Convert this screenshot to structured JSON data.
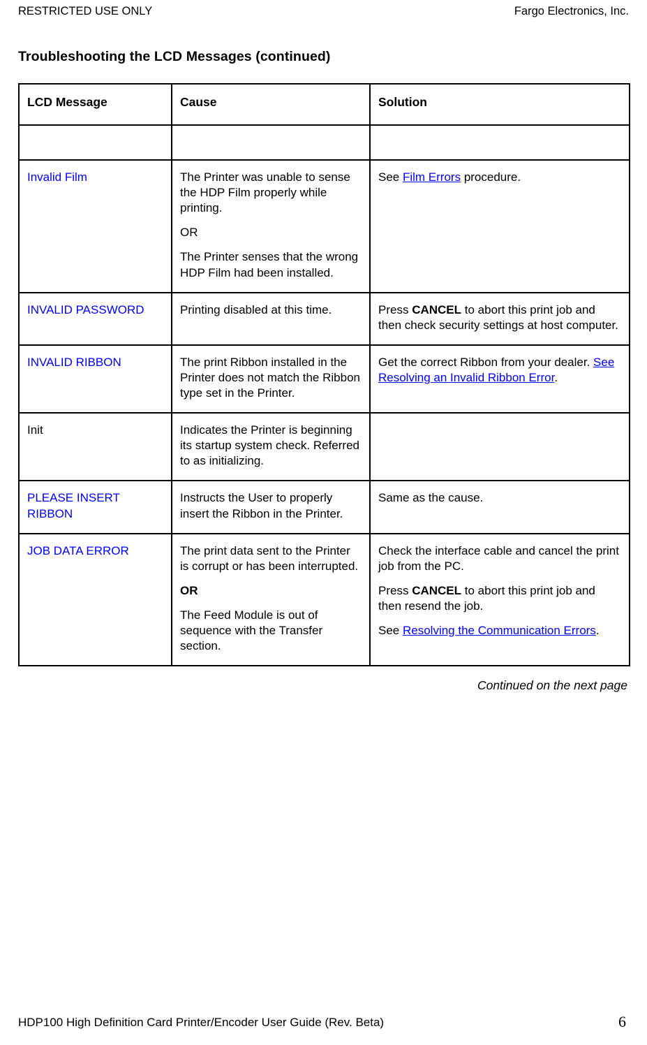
{
  "running_header": {
    "left": "RESTRICTED USE ONLY",
    "right": "Fargo Electronics, Inc."
  },
  "section_title": "Troubleshooting the LCD Messages (continued)",
  "table": {
    "headers": {
      "lcd_message": "LCD Message",
      "cause": "Cause",
      "solution": "Solution"
    },
    "rows": [
      {
        "message": "Invalid Film",
        "message_style": "blue",
        "cause": {
          "p1": "The Printer was unable to sense the HDP Film properly while printing.",
          "p2": "OR",
          "p2_bold": false,
          "p3": "The Printer senses that the wrong HDP Film had been installed."
        },
        "solution": {
          "p1_pre": "See ",
          "p1_link": "Film Errors",
          "p1_post": " procedure."
        }
      },
      {
        "message": "INVALID PASSWORD",
        "message_style": "blue",
        "cause": {
          "p1": "Printing disabled at this time."
        },
        "solution": {
          "p1_pre": "Press ",
          "p1_bold": "CANCEL",
          "p1_post": " to abort this print job and then check security settings at host computer."
        }
      },
      {
        "message": "INVALID RIBBON",
        "message_style": "blue",
        "cause": {
          "p1": "The print Ribbon installed in the Printer does not match the Ribbon type set in the Printer."
        },
        "solution": {
          "p1_pre": "Get the correct Ribbon from your dealer. ",
          "p1_link": "See Resolving an Invalid Ribbon Error",
          "p1_post": "."
        }
      },
      {
        "message": "Init",
        "message_style": "plain",
        "cause": {
          "p1": "Indicates the Printer is beginning its startup system check. Referred to as initializing."
        },
        "solution": {
          "empty": ""
        }
      },
      {
        "message": "PLEASE INSERT RIBBON",
        "message_style": "blue",
        "cause": {
          "p1": "Instructs the User to properly insert the Ribbon in the Printer."
        },
        "solution": {
          "p1": "Same as the cause."
        }
      },
      {
        "message": "JOB DATA ERROR",
        "message_style": "blue",
        "cause": {
          "p1": "The print data sent to the Printer is corrupt or has been interrupted.",
          "p2": "OR",
          "p2_bold": true,
          "p3": "The Feed Module is out of sequence with the Transfer section."
        },
        "solution": {
          "p1": "Check the interface cable and cancel the print job from the PC.",
          "p2_pre": "Press ",
          "p2_bold": "CANCEL",
          "p2_post": " to abort this print job and then resend the job.",
          "p3_pre": "See ",
          "p3_link": "Resolving the Communication Errors",
          "p3_post": "."
        }
      }
    ]
  },
  "continued_note": "Continued on the next page",
  "page_footer": {
    "text": "HDP100 High Definition Card Printer/Encoder User Guide (Rev. Beta)",
    "page_number": "6"
  },
  "colors": {
    "link": "#0000ff",
    "message": "#0000ff",
    "text": "#000000"
  }
}
